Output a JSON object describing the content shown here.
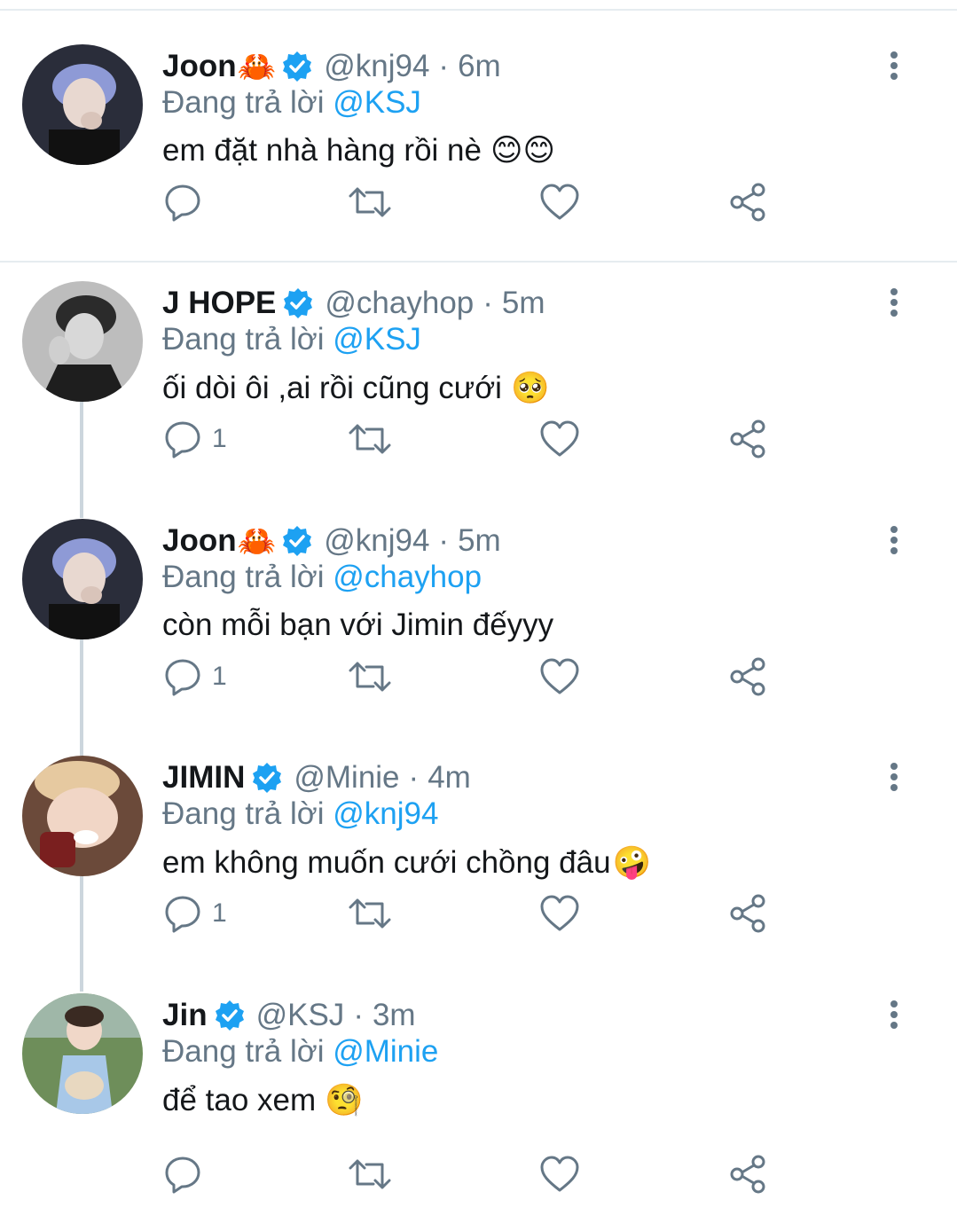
{
  "reply_prefix": "Đang trả lời",
  "tweets": [
    {
      "name": "Joon",
      "name_emoji": "🦀",
      "handle": "@knj94",
      "separator": "·",
      "time": "6m",
      "reply_to": "@KSJ",
      "text": "em đặt nhà hàng rồi nè",
      "text_emoji": "😊😊",
      "reply_count": "",
      "avatar": "rm-portrait"
    },
    {
      "name": "J HOPE",
      "name_emoji": "",
      "handle": "@chayhop",
      "separator": "·",
      "time": "5m",
      "reply_to": "@KSJ",
      "text": "ối dòi ôi ,ai rồi cũng cưới",
      "text_emoji": "🥺",
      "reply_count": "1",
      "avatar": "jhope-portrait-bw"
    },
    {
      "name": "Joon",
      "name_emoji": "🦀",
      "handle": "@knj94",
      "separator": "·",
      "time": "5m",
      "reply_to": "@chayhop",
      "text": "còn mỗi bạn với Jimin đếyyy",
      "text_emoji": "",
      "reply_count": "1",
      "avatar": "rm-portrait"
    },
    {
      "name": "JIMIN",
      "name_emoji": "",
      "handle": "@Minie",
      "separator": "·",
      "time": "4m",
      "reply_to": "@knj94",
      "text": "em không muốn cưới chồng đâu",
      "text_emoji": "🤪",
      "reply_count": "1",
      "avatar": "jimin-portrait"
    },
    {
      "name": "Jin",
      "name_emoji": "",
      "handle": "@KSJ",
      "separator": "·",
      "time": "3m",
      "reply_to": "@Minie",
      "text": "để tao xem",
      "text_emoji": "🧐",
      "reply_count": "",
      "avatar": "jin-portrait"
    }
  ],
  "icons": {
    "verified": "verified-badge-icon",
    "more": "more-vertical-icon",
    "reply": "reply-bubble-icon",
    "retweet": "retweet-icon",
    "like": "heart-icon",
    "share": "share-icon"
  },
  "colors": {
    "accent": "#1da1f2",
    "secondary_text": "#657786",
    "primary_text": "#14171a",
    "divider": "#e6ecf0",
    "thread_line": "#ccd6dd"
  }
}
